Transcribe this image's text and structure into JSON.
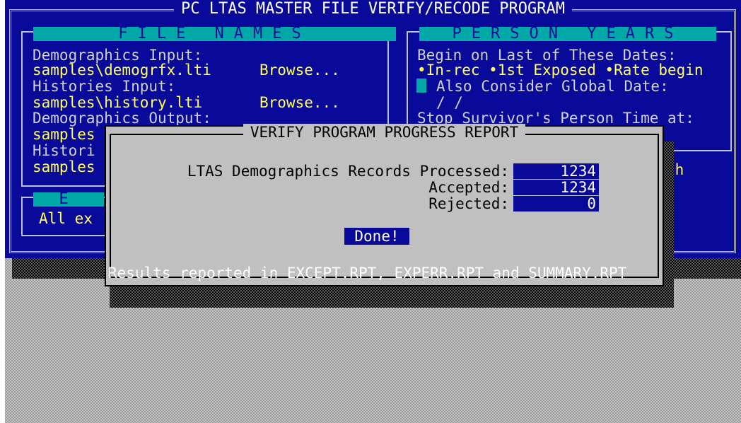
{
  "window": {
    "title": "PC LTAS MASTER FILE VERIFY/RECODE PROGRAM"
  },
  "file_names": {
    "header": "FILE NAMES",
    "demographics_input_label": "Demographics Input:",
    "demographics_input_value": "samples\\demogrfx.lti",
    "histories_input_label": "Histories Input:",
    "histories_input_value": "samples\\history.lti",
    "demographics_output_label": "Demographics Output:",
    "demographics_output_value_partial": "samples",
    "histories_output_label_partial": "Histori",
    "histories_output_value_partial": "samples",
    "browse_label": "Browse..."
  },
  "exceptions_panel": {
    "header_partial": "E",
    "value_partial": "All ex"
  },
  "person_years": {
    "header": "PERSON YEARS",
    "begin_label": "Begin on Last of These Dates:",
    "options_line": "•In-rec •1st Exposed •Rate begin",
    "global_date_label": "Also Consider Global Date:",
    "global_date_value": "/  /",
    "stop_label": "Stop Survivor's Person Time at:",
    "partial_right_text": "th"
  },
  "dialog": {
    "title": "VERIFY PROGRAM PROGRESS REPORT",
    "processed_label": "LTAS Demographics Records Processed:",
    "processed_value": "1234",
    "accepted_label": "Accepted:",
    "accepted_value": "1234",
    "rejected_label": "Rejected:",
    "rejected_value": "0",
    "done_button": "Done!",
    "status": "Results reported in EXCEPT.RPT, EXPERR.RPT and SUMMARY.RPT"
  },
  "colors": {
    "background_blue": "#0a0a9a",
    "header_cyan": "#00a8a8",
    "value_yellow": "#ffff55",
    "dialog_gray": "#c0c0c0"
  }
}
